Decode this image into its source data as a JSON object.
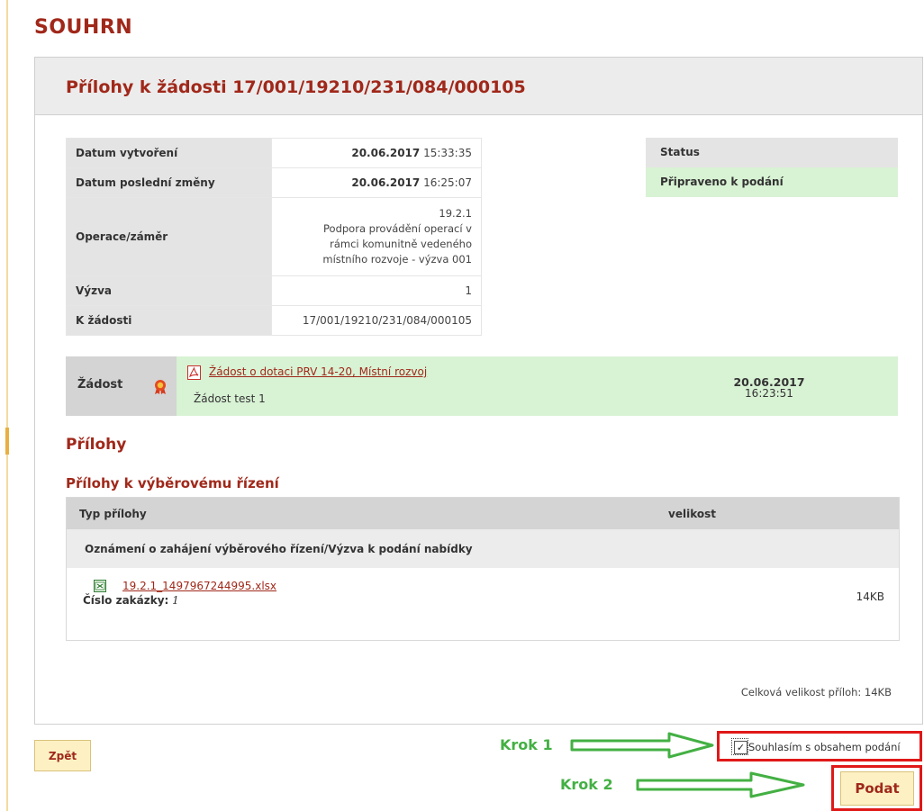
{
  "page": {
    "heading": "SOUHRN"
  },
  "panel": {
    "title": "Přílohy k žádosti 17/001/19210/231/084/000105"
  },
  "info": {
    "created_label": "Datum vytvoření",
    "created_date": "20.06.2017",
    "created_time": "15:33:35",
    "modified_label": "Datum poslední změny",
    "modified_date": "20.06.2017",
    "modified_time": "16:25:07",
    "operation_label": "Operace/záměr",
    "operation_value": [
      "19.2.1",
      "Podpora provádění operací v",
      "rámci komunitně vedeného",
      "místního rozvoje - výzva 001"
    ],
    "call_label": "Výzva",
    "call_value": "1",
    "app_label": "K žádosti",
    "app_value": "17/001/19210/231/084/000105"
  },
  "status": {
    "label": "Status",
    "value": "Připraveno k podání"
  },
  "application": {
    "label": "Žádost",
    "icon": "award-ribbon-icon",
    "link": "Žádost o dotaci PRV 14-20, Místní rozvoj",
    "note": "Žádost test 1",
    "date": "20.06.2017",
    "time": "16:23:51"
  },
  "attachments": {
    "title": "Přílohy",
    "subtitle": "Přílohy k výběrovému řízení",
    "col_type": "Typ přílohy",
    "col_size": "velikost",
    "group": "Oznámení o zahájení výběrového řízení/Výzva k podání nabídky",
    "file_name": "19.2.1_1497967244995.xlsx",
    "order_label": "Číslo zakázky:",
    "order_value": "1",
    "file_size": "14KB",
    "total": "Celková velikost příloh: 14KB"
  },
  "controls": {
    "back": "Zpět",
    "step1": "Krok 1",
    "step2": "Krok 2",
    "consent": "Souhlasím s obsahem podání",
    "consent_checked": true,
    "submit": "Podat"
  },
  "colors": {
    "accent": "#a0281a",
    "ready": "#d8f2d4",
    "highlight": "#e01818",
    "arrow": "#43b043"
  }
}
